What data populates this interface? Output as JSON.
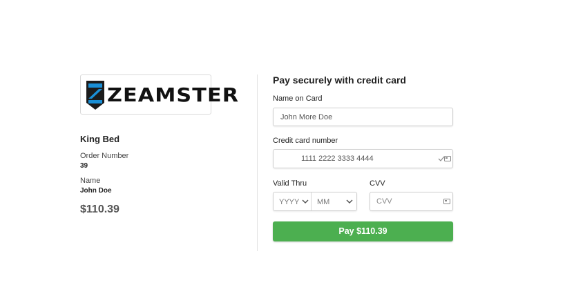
{
  "brand": {
    "name": "ZEAMSTER",
    "colors": {
      "blue": "#1a8fd6",
      "dark": "#1b1b1b"
    }
  },
  "order": {
    "product": "King Bed",
    "order_number_label": "Order Number",
    "order_number": "39",
    "name_label": "Name",
    "name": "John Doe",
    "amount": "$110.39"
  },
  "form": {
    "title": "Pay securely with credit card",
    "name_label": "Name on Card",
    "name_value": "John More Doe",
    "card_label": "Credit card number",
    "card_value": "1111 2222 3333 4444",
    "valid_label": "Valid Thru",
    "year_value": "YYYY",
    "month_value": "MM",
    "cvv_label": "CVV",
    "cvv_placeholder": "CVV",
    "pay_label": "Pay $110.39"
  },
  "colors": {
    "pay_button": "#4caf50"
  },
  "icons": {
    "card_check": "check-icon",
    "card_type": "card-icon",
    "dropdown": "chevron-down-icon"
  }
}
